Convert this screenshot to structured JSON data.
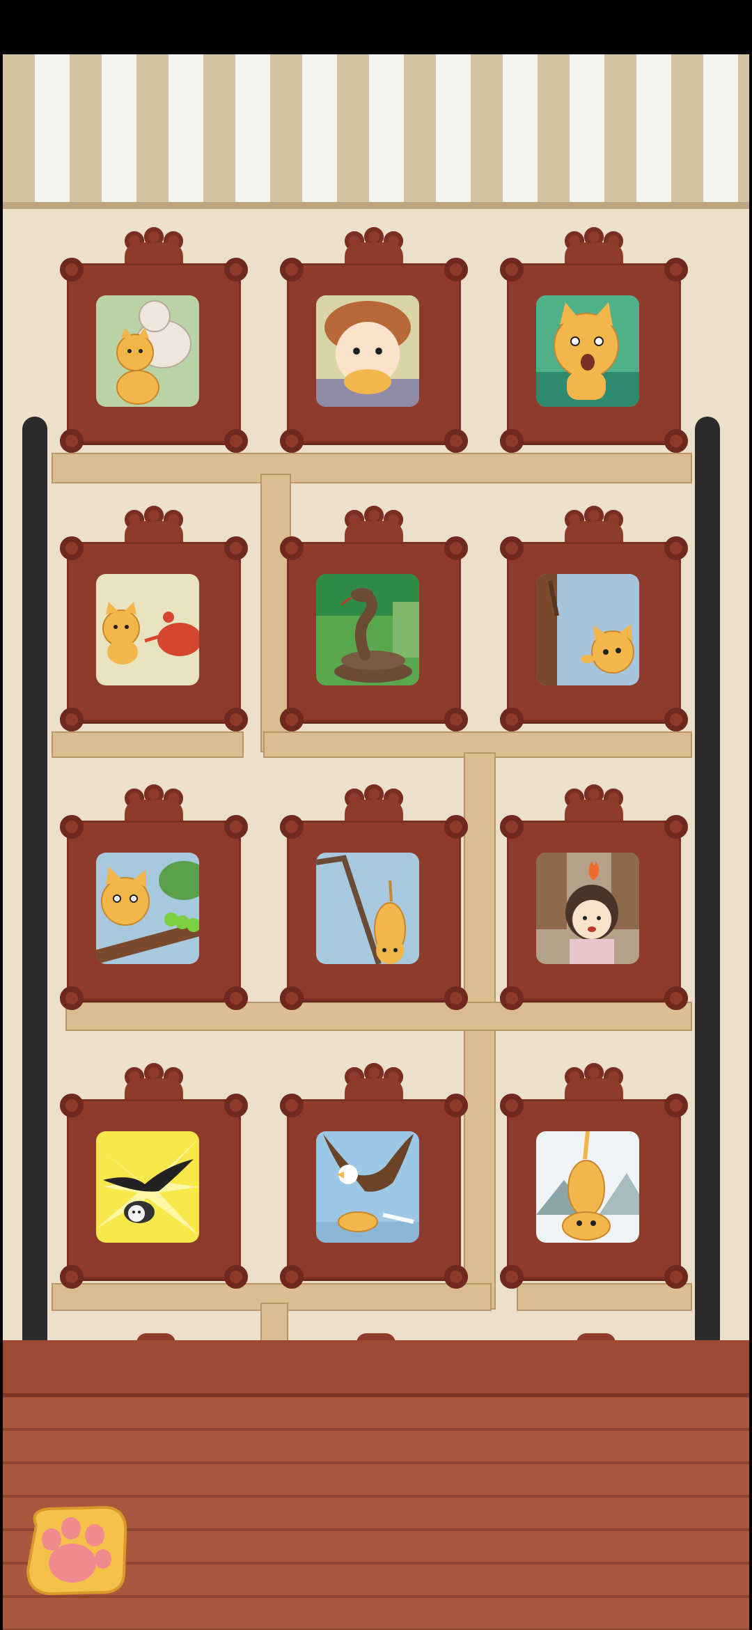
{
  "colors": {
    "wall": "#ede0cb",
    "frame": "#8e3b2c",
    "shelf": "#dbbd92",
    "floor": "#a9573d",
    "pole": "#2b2b2b",
    "paw": "#f4c24b"
  },
  "gallery": {
    "rows": [
      [
        {
          "scene": "cat-and-white-cat",
          "icon": "cat-icon"
        },
        {
          "scene": "boy-holding-cat",
          "icon": "boy-icon"
        },
        {
          "scene": "crying-cat",
          "icon": "cat-icon"
        }
      ],
      [
        {
          "scene": "cat-and-crab",
          "icon": "crab-icon"
        },
        {
          "scene": "snake",
          "icon": "snake-icon"
        },
        {
          "scene": "cat-by-tree",
          "icon": "cat-icon"
        }
      ],
      [
        {
          "scene": "cat-on-branch-with-caterpillar",
          "icon": "caterpillar-icon"
        },
        {
          "scene": "cat-hanging-from-stick",
          "icon": "cat-icon"
        },
        {
          "scene": "angry-girl",
          "icon": "girl-icon"
        }
      ],
      [
        {
          "scene": "crows-attacking",
          "icon": "crow-icon"
        },
        {
          "scene": "eagle-carrying-cat",
          "icon": "eagle-icon"
        },
        {
          "scene": "scared-cat",
          "icon": "cat-icon"
        }
      ]
    ]
  },
  "controls": {
    "paw_button_icon": "paw-icon"
  }
}
